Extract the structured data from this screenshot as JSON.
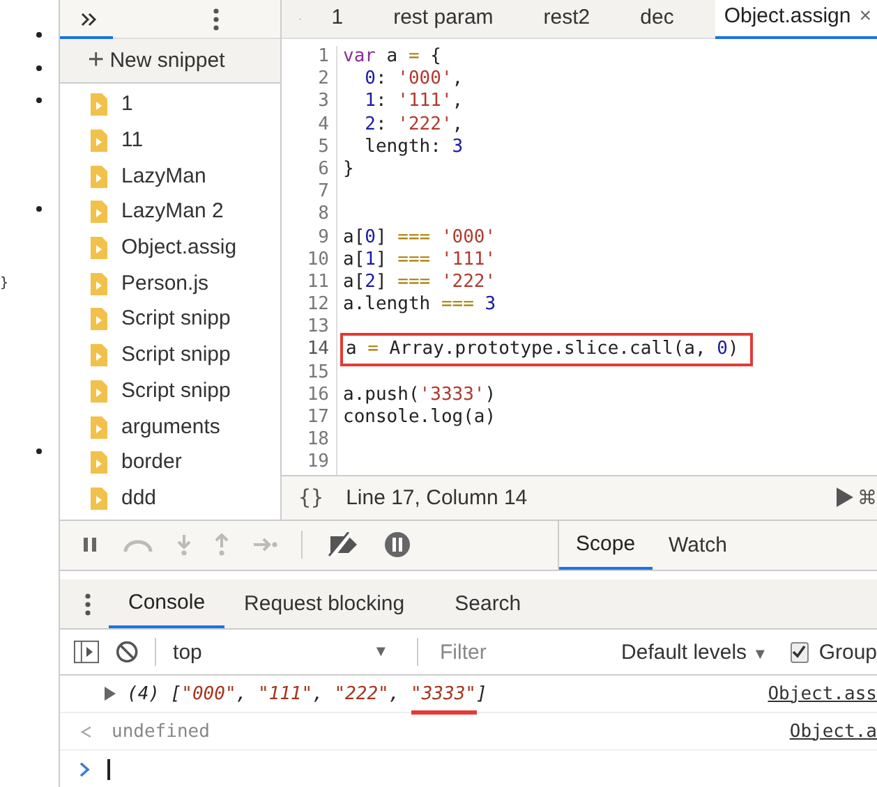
{
  "gutter": {
    "brace": "}"
  },
  "sidebar": {
    "new_snippet_icon": "+",
    "new_snippet": "New snippet",
    "items": [
      {
        "label": "1"
      },
      {
        "label": "11"
      },
      {
        "label": "LazyMan"
      },
      {
        "label": "LazyMan 2"
      },
      {
        "label": "Object.assig"
      },
      {
        "label": "Person.js"
      },
      {
        "label": "Script snipp"
      },
      {
        "label": "Script snipp"
      },
      {
        "label": "Script snipp"
      },
      {
        "label": "arguments"
      },
      {
        "label": "border"
      },
      {
        "label": "ddd"
      }
    ]
  },
  "editor_tabs": [
    {
      "label": "1",
      "selected": false
    },
    {
      "label": "rest param",
      "selected": false
    },
    {
      "label": "rest2",
      "selected": false
    },
    {
      "label": "dec",
      "selected": false
    },
    {
      "label": "Object.assign",
      "selected": true,
      "close": "×"
    }
  ],
  "code_lines": [
    {
      "number": "1",
      "highlighted": false,
      "tokens": [
        {
          "kind": "keyword",
          "text": "var"
        },
        {
          "kind": "plain",
          "text": " a "
        },
        {
          "kind": "operator",
          "text": "="
        },
        {
          "kind": "plain",
          "text": " {"
        }
      ]
    },
    {
      "number": "2",
      "highlighted": false,
      "tokens": [
        {
          "kind": "number",
          "text": "  0"
        },
        {
          "kind": "plain",
          "text": ": "
        },
        {
          "kind": "string",
          "text": "'000'"
        },
        {
          "kind": "plain",
          "text": ","
        }
      ]
    },
    {
      "number": "3",
      "highlighted": false,
      "tokens": [
        {
          "kind": "number",
          "text": "  1"
        },
        {
          "kind": "plain",
          "text": ": "
        },
        {
          "kind": "string",
          "text": "'111'"
        },
        {
          "kind": "plain",
          "text": ","
        }
      ]
    },
    {
      "number": "4",
      "highlighted": false,
      "tokens": [
        {
          "kind": "number",
          "text": "  2"
        },
        {
          "kind": "plain",
          "text": ": "
        },
        {
          "kind": "string",
          "text": "'222'"
        },
        {
          "kind": "plain",
          "text": ","
        }
      ]
    },
    {
      "number": "5",
      "highlighted": false,
      "tokens": [
        {
          "kind": "plain",
          "text": "  length: "
        },
        {
          "kind": "number",
          "text": "3"
        }
      ]
    },
    {
      "number": "6",
      "highlighted": false,
      "tokens": [
        {
          "kind": "plain",
          "text": "}"
        }
      ]
    },
    {
      "number": "7",
      "highlighted": false
    },
    {
      "number": "8",
      "highlighted": false
    },
    {
      "number": "9",
      "highlighted": false,
      "tokens": [
        {
          "kind": "plain",
          "text": "a["
        },
        {
          "kind": "number",
          "text": "0"
        },
        {
          "kind": "plain",
          "text": "] "
        },
        {
          "kind": "operator",
          "text": "==="
        },
        {
          "kind": "string",
          "text": " '000'"
        }
      ]
    },
    {
      "number": "10",
      "highlighted": false,
      "tokens": [
        {
          "kind": "plain",
          "text": "a["
        },
        {
          "kind": "number",
          "text": "1"
        },
        {
          "kind": "plain",
          "text": "] "
        },
        {
          "kind": "operator",
          "text": "==="
        },
        {
          "kind": "string",
          "text": " '111'"
        }
      ]
    },
    {
      "number": "11",
      "highlighted": false,
      "tokens": [
        {
          "kind": "plain",
          "text": "a["
        },
        {
          "kind": "number",
          "text": "2"
        },
        {
          "kind": "plain",
          "text": "] "
        },
        {
          "kind": "operator",
          "text": "==="
        },
        {
          "kind": "string",
          "text": " '222'"
        }
      ]
    },
    {
      "number": "12",
      "highlighted": false,
      "tokens": [
        {
          "kind": "plain",
          "text": "a.length "
        },
        {
          "kind": "operator",
          "text": "==="
        },
        {
          "kind": "number",
          "text": " 3"
        }
      ]
    },
    {
      "number": "13",
      "highlighted": false
    },
    {
      "number": "14",
      "highlighted": true,
      "tokens": [
        {
          "kind": "plain",
          "text": "a "
        },
        {
          "kind": "operator",
          "text": "="
        },
        {
          "kind": "plain",
          "text": " Array.prototype.slice.call(a, "
        },
        {
          "kind": "number",
          "text": "0"
        },
        {
          "kind": "plain",
          "text": ")"
        }
      ]
    },
    {
      "number": "15",
      "highlighted": false
    },
    {
      "number": "16",
      "highlighted": false,
      "tokens": [
        {
          "kind": "plain",
          "text": "a.push("
        },
        {
          "kind": "string",
          "text": "'3333'"
        },
        {
          "kind": "plain",
          "text": ")"
        }
      ]
    },
    {
      "number": "17",
      "highlighted": false,
      "tokens": [
        {
          "kind": "plain",
          "text": "console.log(a)"
        }
      ]
    },
    {
      "number": "18",
      "highlighted": false
    },
    {
      "number": "19",
      "highlighted": false
    }
  ],
  "editor_status": {
    "braces": "{}",
    "position": "Line 17, Column 14",
    "run_shortcut": "⌘"
  },
  "sidebar_panes": [
    {
      "label": "Scope",
      "selected": true
    },
    {
      "label": "Watch",
      "selected": false
    }
  ],
  "drawer_tabs": [
    {
      "label": "Console",
      "selected": true
    },
    {
      "label": "Request blocking",
      "selected": false
    },
    {
      "label": "Search",
      "selected": false
    }
  ],
  "console_toolbar": {
    "context": "top",
    "context_arrow": "▼",
    "filter_placeholder": "Filter",
    "levels": "Default levels",
    "levels_arrow": "▼",
    "group_label": "Group",
    "group_checked": true
  },
  "console_entries": [
    {
      "kind": "output",
      "source": "Object.ass",
      "tokens": [
        {
          "kind": "plain",
          "text": "(4) [",
          "underlined": false
        },
        {
          "kind": "string",
          "text": "\"000\"",
          "underlined": false
        },
        {
          "kind": "plain",
          "text": ", ",
          "underlined": false
        },
        {
          "kind": "string",
          "text": "\"111\"",
          "underlined": false
        },
        {
          "kind": "plain",
          "text": ", ",
          "underlined": false
        },
        {
          "kind": "string",
          "text": "\"222\"",
          "underlined": false
        },
        {
          "kind": "plain",
          "text": ", ",
          "underlined": false
        },
        {
          "kind": "string",
          "text": "\"3333\"",
          "underlined": true
        },
        {
          "kind": "plain",
          "text": "]",
          "underlined": false
        }
      ]
    },
    {
      "kind": "result",
      "source": "Object.a",
      "value": "undefined"
    },
    {
      "kind": "prompt"
    }
  ]
}
